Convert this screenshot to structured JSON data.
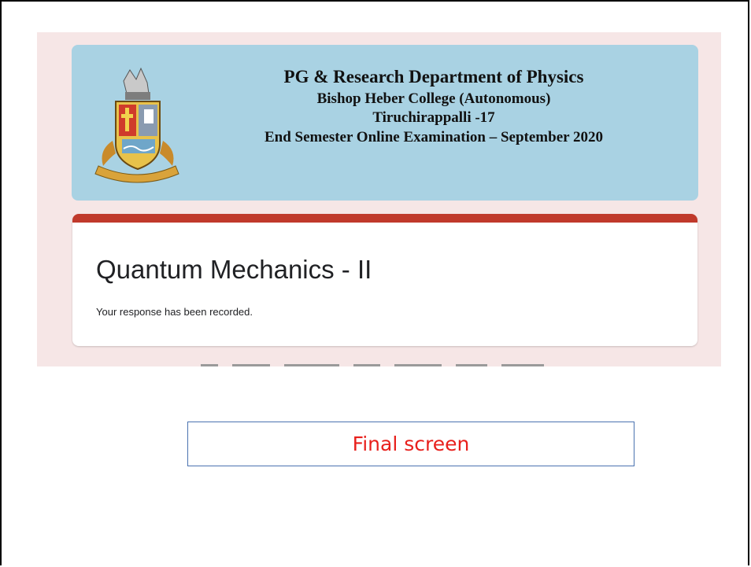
{
  "banner": {
    "line1": "PG & Research Department of Physics",
    "line2": "Bishop Heber College (Autonomous)",
    "line3": "Tiruchirappalli -17",
    "line4": "End Semester Online Examination – September 2020",
    "logo_icon": "college-crest-icon",
    "color": "#a9d2e3"
  },
  "form": {
    "title": "Quantum Mechanics - II",
    "message": "Your response has been recorded.",
    "accent_color": "#c0392b"
  },
  "caption": {
    "label": "Final screen",
    "color": "#e8201c"
  }
}
